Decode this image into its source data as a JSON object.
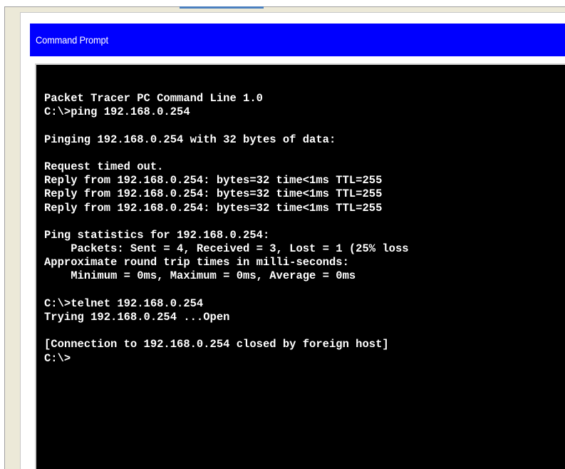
{
  "window": {
    "title": "Command Prompt"
  },
  "colors": {
    "title_bar": "#0000ff",
    "console_background": "#000000",
    "console_text": "#ffffff",
    "frame_background": "#ece9d8"
  },
  "console": {
    "lines": [
      "Packet Tracer PC Command Line 1.0",
      "C:\\>ping 192.168.0.254",
      "",
      "Pinging 192.168.0.254 with 32 bytes of data:",
      "",
      "Request timed out.",
      "Reply from 192.168.0.254: bytes=32 time<1ms TTL=255",
      "Reply from 192.168.0.254: bytes=32 time<1ms TTL=255",
      "Reply from 192.168.0.254: bytes=32 time<1ms TTL=255",
      "",
      "Ping statistics for 192.168.0.254:",
      "    Packets: Sent = 4, Received = 3, Lost = 1 (25% loss",
      "Approximate round trip times in milli-seconds:",
      "    Minimum = 0ms, Maximum = 0ms, Average = 0ms",
      "",
      "C:\\>telnet 192.168.0.254",
      "Trying 192.168.0.254 ...Open",
      "",
      "[Connection to 192.168.0.254 closed by foreign host]",
      "C:\\>"
    ]
  }
}
